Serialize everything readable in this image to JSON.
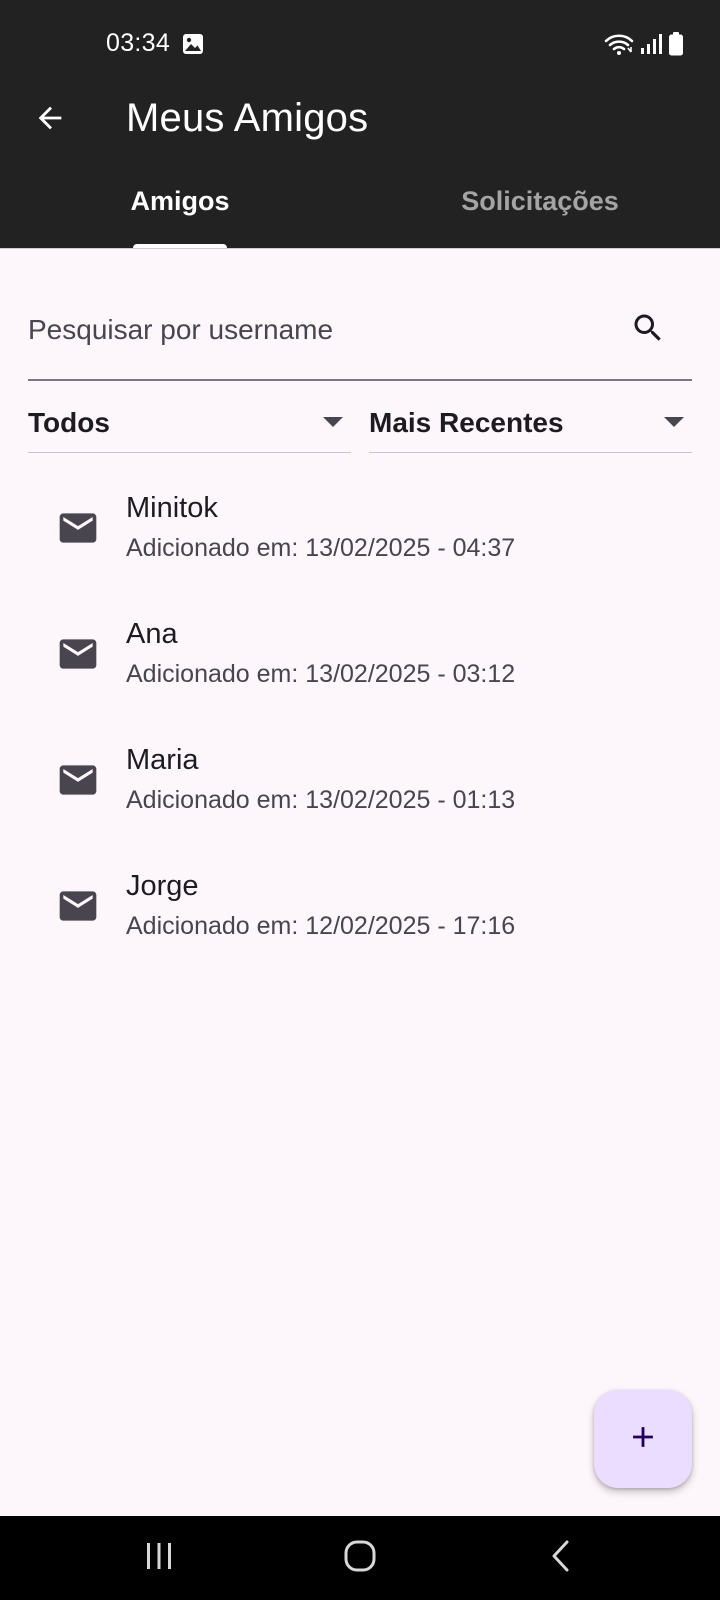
{
  "status_bar": {
    "time": "03:34",
    "icons": [
      "image-icon",
      "wifi-icon",
      "signal-icon",
      "battery-icon"
    ]
  },
  "app_bar": {
    "title": "Meus Amigos",
    "back_icon": "arrow-back-icon"
  },
  "tabs": [
    {
      "label": "Amigos",
      "selected": true
    },
    {
      "label": "Solicitações",
      "selected": false
    }
  ],
  "search": {
    "placeholder": "Pesquisar por username",
    "value": "",
    "icon": "search-icon"
  },
  "filters": {
    "type": {
      "selected": "Todos"
    },
    "sort": {
      "selected": "Mais Recentes"
    }
  },
  "friends": [
    {
      "name": "Minitok",
      "added": "Adicionado em: 13/02/2025 - 04:37",
      "icon": "mail-icon"
    },
    {
      "name": "Ana",
      "added": "Adicionado em: 13/02/2025 - 03:12",
      "icon": "mail-icon"
    },
    {
      "name": "Maria",
      "added": "Adicionado em: 13/02/2025 - 01:13",
      "icon": "mail-icon"
    },
    {
      "name": "Jorge",
      "added": "Adicionado em: 12/02/2025 - 17:16",
      "icon": "mail-icon"
    }
  ],
  "fab": {
    "icon": "add-icon"
  },
  "nav_bar": {
    "icons": [
      "recents-icon",
      "home-icon",
      "back-icon"
    ]
  },
  "colors": {
    "app_bar_bg": "#222222",
    "background": "#fdf7fc",
    "fab_bg": "#eaddff",
    "fab_icon": "#21005d",
    "tab_inactive": "#a4a4a4"
  }
}
